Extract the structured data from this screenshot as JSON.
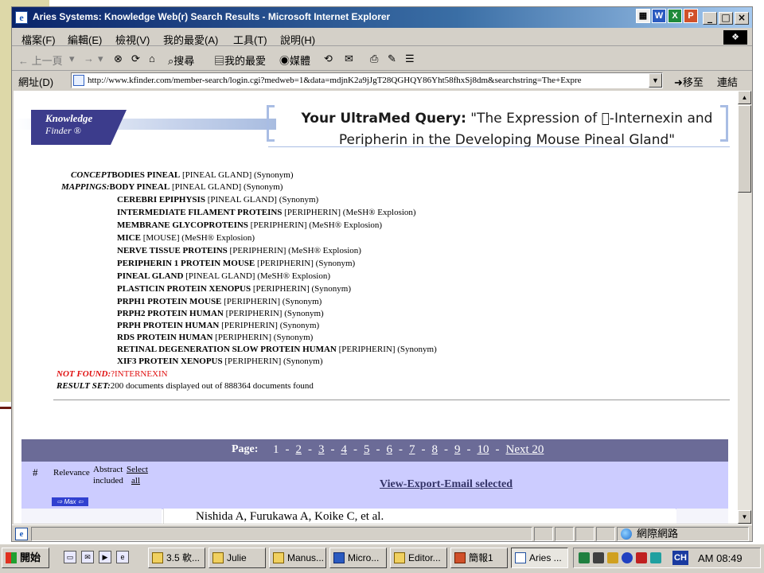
{
  "window": {
    "title": "Aries Systems: Knowledge Web(r) Search Results - Microsoft Internet Explorer",
    "app_icon": "e",
    "office_tray": [
      "W",
      "X",
      "P"
    ],
    "buttons": {
      "minimize": "_",
      "maximize": "□",
      "close": "×"
    }
  },
  "menubar": {
    "items": [
      "檔案(F)",
      "編輯(E)",
      "檢視(V)",
      "我的最愛(A)",
      "工具(T)",
      "說明(H)"
    ]
  },
  "toolbar": {
    "back": "← 上一頁",
    "forward": "→",
    "stop": "⊗",
    "refresh": "⟳",
    "home": "⌂",
    "search": "搜尋",
    "favorites": "我的最愛",
    "media": "媒體",
    "history": "⟲",
    "mail": "✉",
    "print": "⎙",
    "edit": "✎",
    "discuss": "☰"
  },
  "address": {
    "label": "網址(D)",
    "url": "http://www.kfinder.com/member-search/login.cgi?medweb=1&data=mdjnK2a9jJgT28QGHQY86Yht58fhxSj8dm&searchstring=The+Expre",
    "go": "移至",
    "links": "連結"
  },
  "page": {
    "logo_line1": "Knowledge",
    "logo_line2": "Finder ®",
    "query_label": "Your UltraMed Query:",
    "query_text": " \"The Expression of 𪩴-Internexin and Peripherin in the Developing Mouse Pineal Gland\"",
    "concept_label": "CONCEPT",
    "mappings_label": "MAPPINGS:",
    "mappings": [
      {
        "term": "BODIES PINEAL",
        "detail": " [PINEAL GLAND] (Synonym)"
      },
      {
        "term": "BODY PINEAL",
        "detail": " [PINEAL GLAND] (Synonym)"
      },
      {
        "term": "CEREBRI EPIPHYSIS",
        "detail": " [PINEAL GLAND] (Synonym)"
      },
      {
        "term": "INTERMEDIATE FILAMENT PROTEINS",
        "detail": " [PERIPHERIN] (MeSH® Explosion)"
      },
      {
        "term": "MEMBRANE GLYCOPROTEINS",
        "detail": " [PERIPHERIN] (MeSH® Explosion)"
      },
      {
        "term": "MICE",
        "detail": " [MOUSE] (MeSH® Explosion)"
      },
      {
        "term": "NERVE TISSUE PROTEINS",
        "detail": " [PERIPHERIN] (MeSH® Explosion)"
      },
      {
        "term": "PERIPHERIN 1 PROTEIN MOUSE",
        "detail": " [PERIPHERIN] (Synonym)"
      },
      {
        "term": "PINEAL GLAND",
        "detail": " [PINEAL GLAND] (MeSH® Explosion)"
      },
      {
        "term": "PLASTICIN PROTEIN XENOPUS",
        "detail": " [PERIPHERIN] (Synonym)"
      },
      {
        "term": "PRPH1 PROTEIN MOUSE",
        "detail": " [PERIPHERIN] (Synonym)"
      },
      {
        "term": "PRPH2 PROTEIN HUMAN",
        "detail": " [PERIPHERIN] (Synonym)"
      },
      {
        "term": "PRPH PROTEIN HUMAN",
        "detail": " [PERIPHERIN] (Synonym)"
      },
      {
        "term": "RDS PROTEIN HUMAN",
        "detail": " [PERIPHERIN] (Synonym)"
      },
      {
        "term": "RETINAL DEGENERATION SLOW PROTEIN HUMAN",
        "detail": " [PERIPHERIN] (Synonym)"
      },
      {
        "term": "XIF3 PROTEIN XENOPUS",
        "detail": " [PERIPHERIN] (Synonym)"
      }
    ],
    "not_found_label": "NOT FOUND:",
    "not_found_value": "?INTERNEXIN",
    "result_label": "RESULT SET:",
    "result_value": "200 documents displayed out of 888364 documents found",
    "pager_label": "Page:",
    "pages": [
      "1",
      "2",
      "3",
      "4",
      "5",
      "6",
      "7",
      "8",
      "9",
      "10",
      "Next 20"
    ],
    "pager_sep": "-",
    "col_hash": "#",
    "col_relevance": "Relevance",
    "col_abstract_1": "Abstract",
    "col_abstract_2": "included",
    "col_select_1": "Select",
    "col_select_2": "all",
    "view_export": "View-Export-Email selected",
    "max_button": "⇨ Max ⇦",
    "first_result_authors": "Nishida A, Furukawa A, Koike C, et al."
  },
  "status": {
    "zone": "網際網路"
  },
  "taskbar": {
    "start": "開始",
    "tasks": [
      "3.5 軟...",
      "Julie",
      "Manus...",
      "Micro...",
      "Editor...",
      "簡報1",
      "Aries ..."
    ],
    "ime": "CH",
    "clock": "AM 08:49"
  }
}
